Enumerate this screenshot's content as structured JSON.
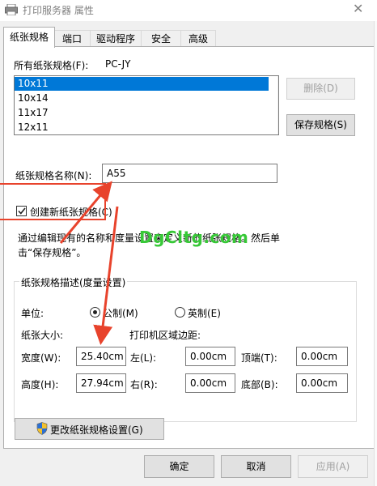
{
  "window": {
    "title": "打印服务器 属性",
    "close_glyph": "✕"
  },
  "tabs": [
    {
      "label": "纸张规格",
      "active": true
    },
    {
      "label": "端口"
    },
    {
      "label": "驱动程序"
    },
    {
      "label": "安全"
    },
    {
      "label": "高级"
    }
  ],
  "forms": {
    "label": "所有纸张规格(F):",
    "server": "PC-JY",
    "items": [
      "10x11",
      "10x14",
      "11x17",
      "12x11"
    ],
    "selected": "10x11"
  },
  "buttons": {
    "delete": "删除(D)",
    "save": "保存规格(S)",
    "change_settings": "更改纸张规格设置(G)",
    "ok": "确定",
    "cancel": "取消",
    "apply": "应用(A)"
  },
  "form_name": {
    "label": "纸张规格名称(N):",
    "value": "A55"
  },
  "create_new": {
    "label": "创建新纸张规格(C)",
    "checked": true
  },
  "description": {
    "line1": "通过编辑现有的名称和度量设置来定义新的纸张规格。然后单",
    "line2": "击“保存规格”。"
  },
  "watermark": "DgCltg.com",
  "group": {
    "title": "纸张规格描述(度量设置)",
    "unit_label": "单位:",
    "metric": "公制(M)",
    "imperial": "英制(E)",
    "selected_unit": "metric",
    "paper_size_label": "纸张大小:",
    "margins_label": "打印机区域边距:",
    "width_label": "宽度(W):",
    "width": "25.40cm",
    "height_label": "高度(H):",
    "height": "27.94cm",
    "left_label": "左(L):",
    "left": "0.00cm",
    "right_label": "右(R):",
    "right": "0.00cm",
    "top_label": "顶端(T):",
    "top": "0.00cm",
    "bottom_label": "底部(B):",
    "bottom": "0.00cm"
  },
  "colors": {
    "accent": "#0078d7",
    "annotation": "#e8432c",
    "watermark": "#37c837",
    "shield_blue": "#2a6fd6",
    "shield_yellow": "#f2c12e"
  },
  "icons": {
    "window": "printer-icon",
    "shield": "uac-shield-icon",
    "check": "checkmark-icon"
  }
}
